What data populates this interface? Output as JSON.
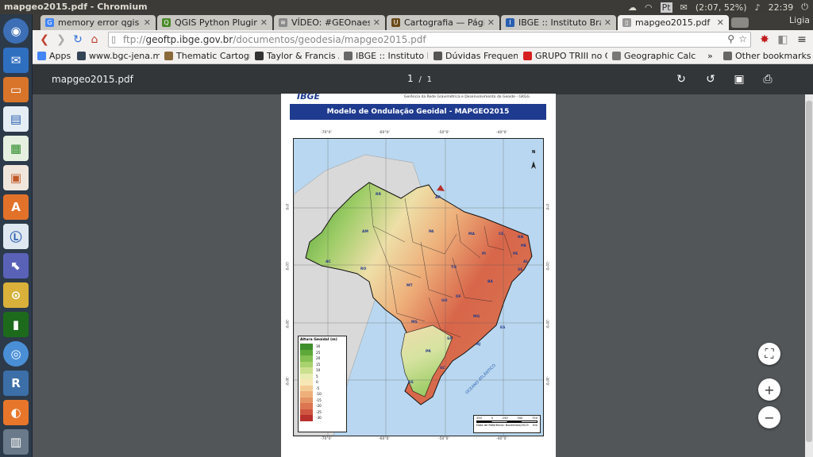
{
  "window_title": "mapgeo2015.pdf - Chromium",
  "system_tray": {
    "lang": "Pt",
    "battery": "(2:07, 52%)",
    "clock": "22:39"
  },
  "tabs": [
    {
      "label": "memory error qgis s",
      "color": "#4285f4",
      "glyph": "G"
    },
    {
      "label": "QGIS Python Plugins",
      "color": "#4a8a2a",
      "glyph": "Q"
    },
    {
      "label": "VÍDEO: #GEOnaesc",
      "color": "#8a8a8a",
      "glyph": "≋"
    },
    {
      "label": "Cartografia — Págin",
      "color": "#6b4a1a",
      "glyph": "U"
    },
    {
      "label": "IBGE :: Instituto Bras",
      "color": "#2a5fb0",
      "glyph": "I"
    },
    {
      "label": "mapgeo2015.pdf",
      "color": "#999999",
      "glyph": "▯"
    }
  ],
  "user_name": "Ligia",
  "url": {
    "prefix": "ftp://",
    "host": "geoftp.ibge.gov.br",
    "path": "/documentos/geodesia/mapgeo2015.pdf"
  },
  "bookmarks": [
    {
      "label": "Apps",
      "color": "#4285f4"
    },
    {
      "label": "www.bgc-jena.m",
      "color": "#334455"
    },
    {
      "label": "Thematic Cartogr",
      "color": "#8a6a3a"
    },
    {
      "label": "Taylor & Francis A",
      "color": "#333333"
    },
    {
      "label": "IBGE :: Instituto E",
      "color": "#666666"
    },
    {
      "label": "Dúvidas Frequen",
      "color": "#555555"
    },
    {
      "label": "GRUPO TRIII no Q",
      "color": "#d62020"
    },
    {
      "label": "Geographic Calcu",
      "color": "#777777"
    },
    {
      "label": "Other bookmarks",
      "color": "#666666"
    }
  ],
  "pdf": {
    "filename": "mapgeo2015.pdf",
    "page_current": "1",
    "page_sep": "/",
    "page_total": "1"
  },
  "document": {
    "agency": "IBGE",
    "header": "Gerência da Rede Gravimétrica e Desenvolvimento do Geoide - GRGG",
    "title": "Modelo de Ondulação Geoidal - MAPGEO2015",
    "legend_title": "Altura Geoidal (m)",
    "legend_values": [
      "30",
      "25",
      "20",
      "15",
      "10",
      "5",
      "0",
      "-5",
      "-10",
      "-15",
      "-20",
      "-25",
      "-30"
    ],
    "legend_colors": [
      "#3e8f2c",
      "#5ea83a",
      "#84c052",
      "#a9d26e",
      "#cbe08f",
      "#e8ecb1",
      "#f6e7b5",
      "#f3cc95",
      "#eeb07b",
      "#e59465",
      "#dc7551",
      "#cf5640",
      "#b8302c"
    ],
    "lon_labels": [
      "-70°0'",
      "-60°0'",
      "-50°0'",
      "-40°0'"
    ],
    "lat_labels": [
      "0°0'",
      "-10°0'",
      "-20°0'",
      "-30°0'"
    ],
    "states": [
      "RR",
      "AP",
      "AM",
      "PA",
      "MA",
      "CE",
      "RN",
      "PI",
      "PB",
      "PE",
      "AL",
      "SE",
      "AC",
      "RO",
      "TO",
      "BA",
      "MT",
      "GO",
      "DF",
      "MG",
      "ES",
      "MS",
      "SP",
      "RJ",
      "PR",
      "SC",
      "RS"
    ],
    "scale_ticks": [
      "250",
      "0",
      "250",
      "500",
      "750"
    ],
    "scale_unit": "Km",
    "reference_date": "Data de Referência: Novembro/2015",
    "ocean_label": "OCEANO ATLÂNTICO",
    "north_label": "N"
  }
}
